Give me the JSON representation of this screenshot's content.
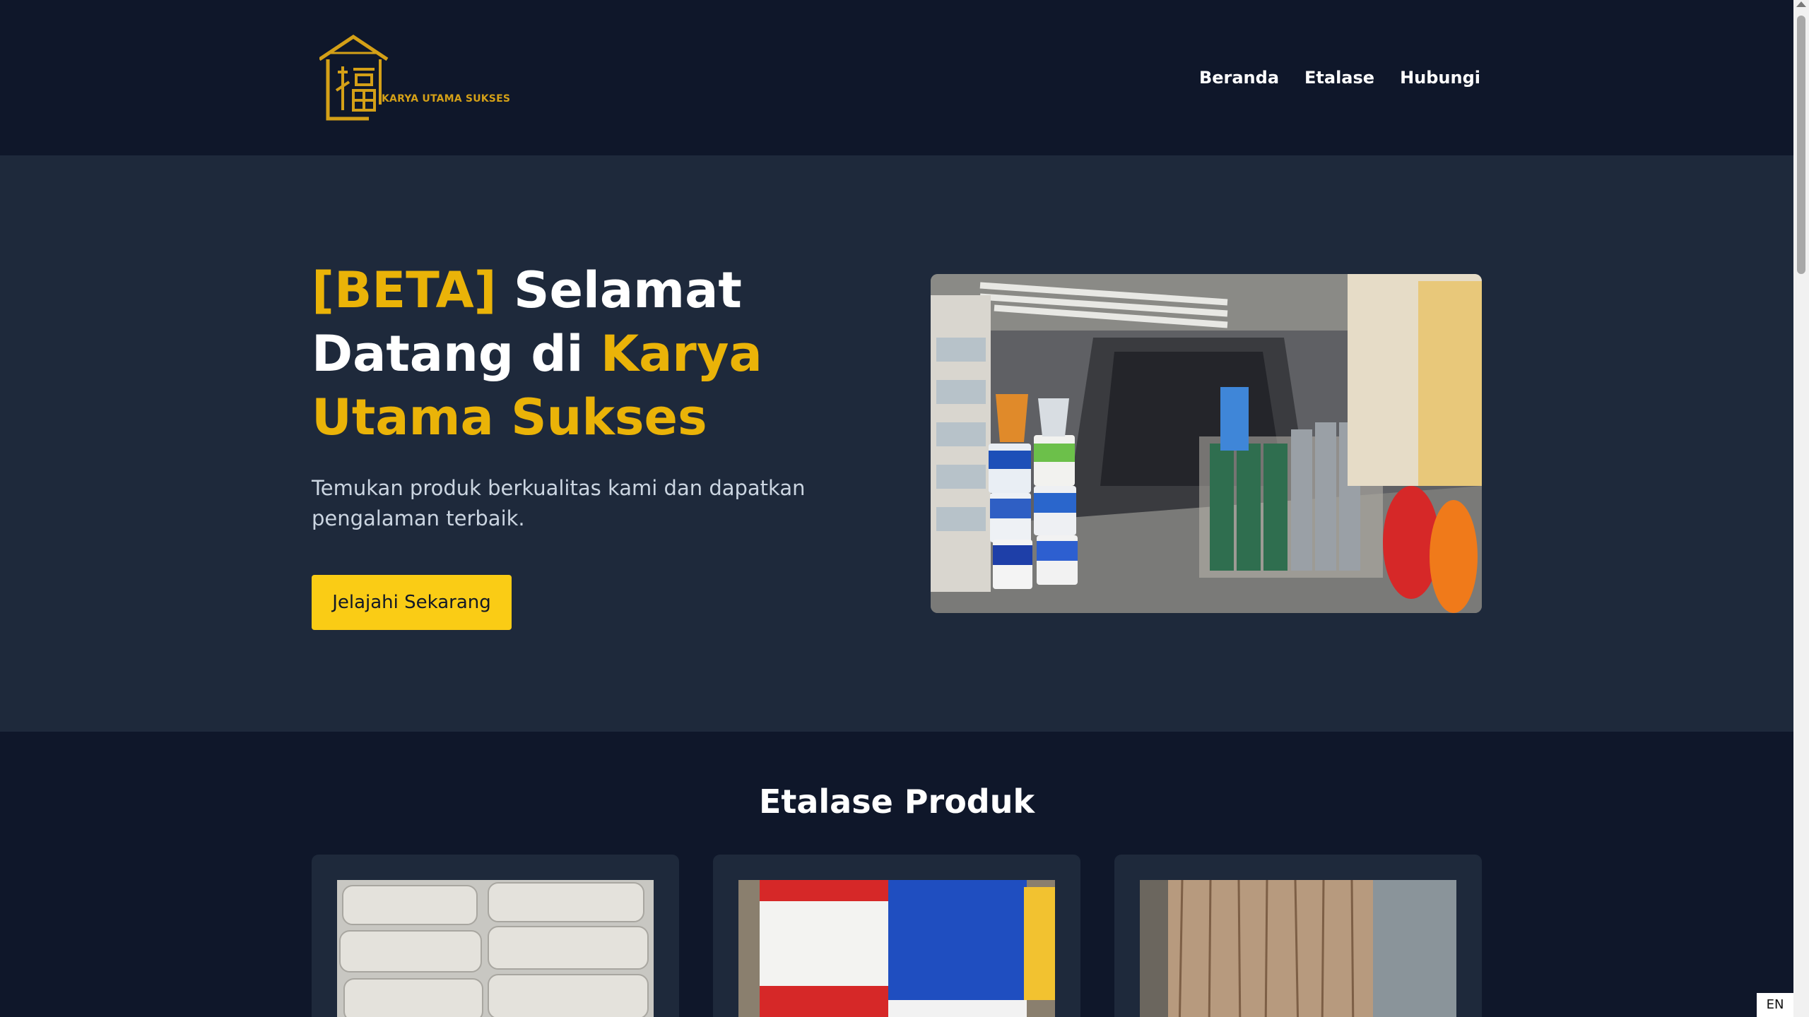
{
  "header": {
    "logo_text": "KARYA UTAMA SUKSES",
    "nav": [
      "Beranda",
      "Etalase",
      "Hubungi"
    ]
  },
  "hero": {
    "title_parts": [
      "[BETA]",
      "Selamat Datang di",
      "Karya Utama Sukses"
    ],
    "subtitle": "Temukan produk berkualitas kami dan dapatkan pengalaman terbaik.",
    "cta_label": "Jelajahi Sekarang"
  },
  "showcase": {
    "title": "Etalase Produk"
  },
  "language_badge": "EN",
  "colors": {
    "background": "#0f172a",
    "hero_background": "#1e293b",
    "accent": "#eab308",
    "button": "#facc15",
    "logo_gold": "#d4a017"
  },
  "icons": [
    "house-logo-icon",
    "fortune-character-icon"
  ]
}
